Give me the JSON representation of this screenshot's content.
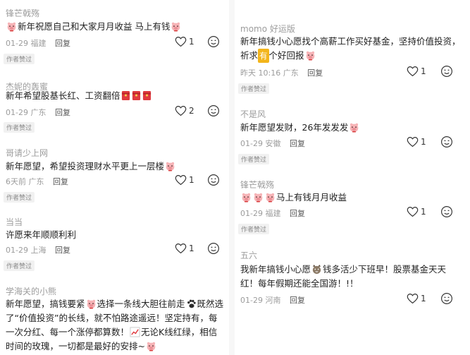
{
  "badge_text": "作者赞过",
  "left_comments": [
    {
      "author": "锋芒戟殇",
      "text": "新年祝愿自己和大家月月收益 马上有钱",
      "date": "01-29",
      "location": "福建",
      "reply": "回复",
      "likes": "1"
    },
    {
      "author": "杰妮的轰蜜",
      "text": "新年希望股基长红、工资翻倍",
      "date": "01-29",
      "location": "广东",
      "reply": "回复",
      "likes": "2"
    },
    {
      "author": "哥请少上网",
      "text": "新年愿望，希望投资理财水平更上一层楼",
      "date": "6天前",
      "location": "广东",
      "reply": "回复",
      "likes": "1"
    },
    {
      "author": "当当",
      "text": "许愿来年顺顺利利",
      "date": "01-29",
      "location": "上海",
      "reply": "回复",
      "likes": "1"
    },
    {
      "author": "学海关的小熊",
      "text_lines": [
        "新年愿望，搞钱要紧",
        "选择一条线大胆往前走",
        "既然选",
        "了“价值投资”的长线，就不怕路途遥远！坚定持有，每",
        "一次分红、每一个涨停都算数！",
        "无论K线红绿，相信",
        "时间的玫瑰，一切都是最好的安排~"
      ]
    }
  ],
  "right_comments": [
    {
      "author": "momo 好运版",
      "text_lines": [
        "新年搞钱小心愿找个高薪工作买好基金，坚持价值投资，",
        "祈求",
        "有",
        "个好回报"
      ],
      "date": "昨天 10:16",
      "location": "广东",
      "reply": "回复",
      "likes": "1"
    },
    {
      "author": "不是风",
      "text": "新年愿望发财，26年发发发",
      "date": "01-29",
      "location": "安徽",
      "reply": "回复",
      "likes": "1"
    },
    {
      "author": "锋芒戟殇",
      "text": "马上有钱月月收益",
      "date": "01-29",
      "location": "福建",
      "reply": "回复",
      "likes": "1"
    },
    {
      "author": "五六",
      "text_lines": [
        "我新年搞钱小心愿",
        "钱多活少下班早！股票基金天天",
        "红！每年假期还能全国游！!！"
      ],
      "date": "01-29",
      "location": "河南",
      "reply": "回复",
      "likes": "1"
    }
  ],
  "colors": {
    "text": "#1f1f1f",
    "muted": "#9c9c9c",
    "badge_bg": "#f1f1f1",
    "emoji_red": "#e0393e"
  }
}
